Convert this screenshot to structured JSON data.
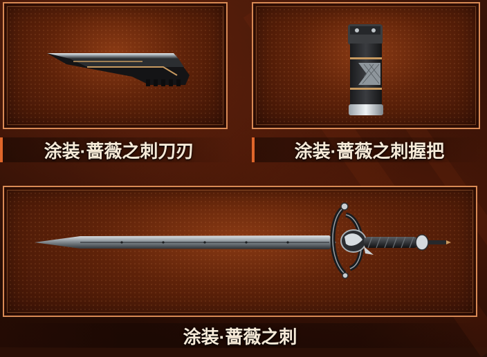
{
  "items": [
    {
      "id": "blade",
      "name": "涂装·蔷薇之刺刀刃"
    },
    {
      "id": "grip",
      "name": "涂装·蔷薇之刺握把"
    },
    {
      "id": "sword",
      "name": "涂装·蔷薇之刺"
    }
  ],
  "colors": {
    "frame": "#d98a55",
    "accent": "#e0662a",
    "label_text": "#f6ead8",
    "background": "#2a0f06"
  },
  "icons": [
    "blade-part-icon",
    "grip-part-icon",
    "sword-icon"
  ]
}
